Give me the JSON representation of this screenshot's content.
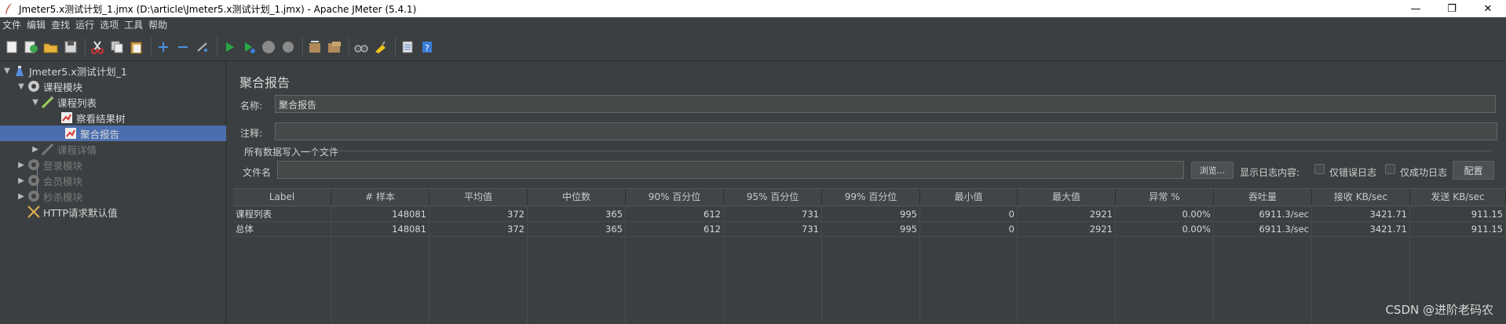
{
  "window": {
    "title": "Jmeter5.x测试计划_1.jmx (D:\\article\\Jmeter5.x测试计划_1.jmx) - Apache JMeter (5.4.1)",
    "controls": {
      "minimize": "—",
      "restore": "❐",
      "close": "✕"
    }
  },
  "menu": [
    "文件",
    "编辑",
    "查找",
    "运行",
    "选项",
    "工具",
    "帮助"
  ],
  "toolbar": [
    "new-icon",
    "templates-icon",
    "open-icon",
    "save-icon",
    "cut-icon",
    "copy-icon",
    "paste-icon",
    "expand-icon",
    "collapse-icon",
    "toggle-icon",
    "start-icon",
    "start-no-timers-icon",
    "stop-icon",
    "shutdown-icon",
    "clear-icon",
    "clear-all-icon",
    "search-icon",
    "reset-search-icon",
    "function-helper-icon",
    "help-icon"
  ],
  "tree": {
    "items": [
      {
        "label": "Jmeter5.x测试计划_1",
        "icon": "test-plan-icon",
        "level": 0,
        "expanded": true
      },
      {
        "label": "课程模块",
        "icon": "thread-group-icon",
        "level": 1,
        "expanded": true
      },
      {
        "label": "课程列表",
        "icon": "http-sampler-icon",
        "level": 2,
        "expanded": true
      },
      {
        "label": "察看结果树",
        "icon": "listener-icon",
        "level": 3
      },
      {
        "label": "聚合报告",
        "icon": "listener-icon",
        "level": 3,
        "selected": true
      },
      {
        "label": "课程详情",
        "icon": "http-sampler-icon",
        "level": 2,
        "disabled": true
      },
      {
        "label": "登录模块",
        "icon": "thread-group-icon",
        "level": 1,
        "disabled": true
      },
      {
        "label": "会员模块",
        "icon": "thread-group-icon",
        "level": 1,
        "disabled": true
      },
      {
        "label": "秒杀模块",
        "icon": "thread-group-icon",
        "level": 1,
        "disabled": true
      },
      {
        "label": "HTTP请求默认值",
        "icon": "config-icon",
        "level": 1
      }
    ]
  },
  "panel": {
    "title": "聚合报告",
    "name_label": "名称:",
    "name_value": "聚合报告",
    "comment_label": "注释:",
    "comment_value": "",
    "section_title": "所有数据写入一个文件",
    "filename_label": "文件名",
    "filename_value": "",
    "browse_button": "浏览...",
    "log_label": "显示日志内容:",
    "errors_only_label": "仅错误日志",
    "success_only_label": "仅成功日志",
    "configure_button": "配置"
  },
  "table": {
    "columns": [
      "Label",
      "# 样本",
      "平均值",
      "中位数",
      "90% 百分位",
      "95% 百分位",
      "99% 百分位",
      "最小值",
      "最大值",
      "异常 %",
      "吞吐量",
      "接收 KB/sec",
      "发送 KB/sec"
    ],
    "rows": [
      [
        "课程列表",
        "148081",
        "372",
        "365",
        "612",
        "731",
        "995",
        "0",
        "2921",
        "0.00%",
        "6911.3/sec",
        "3421.71",
        "911.15"
      ],
      [
        "总体",
        "148081",
        "372",
        "365",
        "612",
        "731",
        "995",
        "0",
        "2921",
        "0.00%",
        "6911.3/sec",
        "3421.71",
        "911.15"
      ]
    ]
  },
  "watermark": "CSDN @进阶老码农",
  "colors": {
    "background": "#3c3f41",
    "selection": "#4b6eaf"
  }
}
